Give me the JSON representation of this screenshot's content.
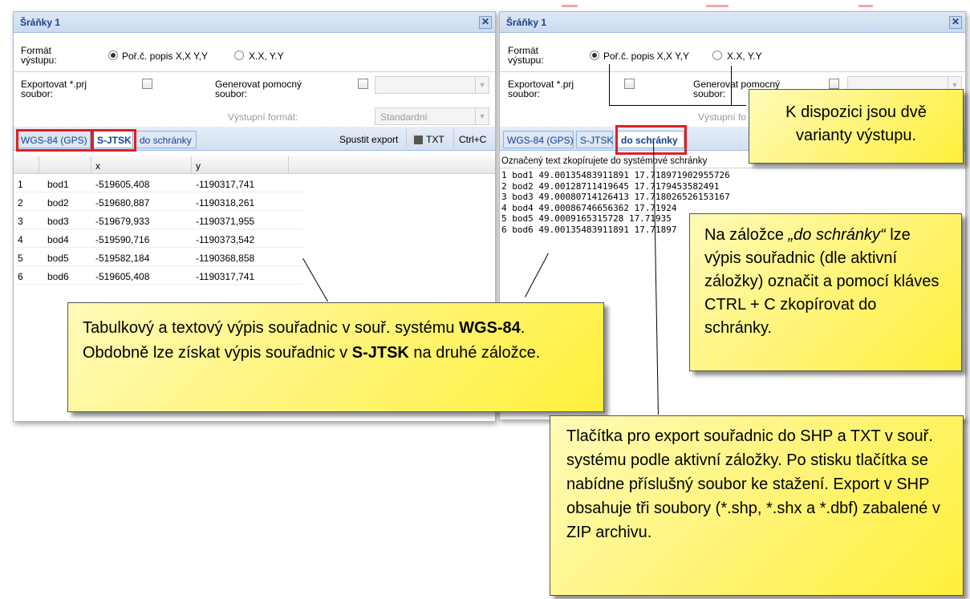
{
  "left_window": {
    "title": "Šráňky 1",
    "close_glyph": "✕",
    "format_label": "Formát výstupu:",
    "radio_options": [
      "Poř.č. popis X,X Y,Y",
      "X.X, Y.Y"
    ],
    "export_prj_label": "Exportovat *.prj soubor:",
    "generate_aux_label": "Generovat pomocný soubor:",
    "output_format_label": "Výstupní formát:",
    "output_format_value": "Standardní",
    "tabs": [
      "WGS-84 (GPS)",
      "S-JTSK",
      "do schránky"
    ],
    "buttons": {
      "export": "Spustit export",
      "txt": "TXT",
      "copy": "Ctrl+C"
    },
    "grid_headers": [
      "x",
      "y"
    ],
    "rows": [
      {
        "n": "1",
        "name": "bod1",
        "x": "-519605,408",
        "y": "-1190317,741"
      },
      {
        "n": "2",
        "name": "bod2",
        "x": "-519680,887",
        "y": "-1190318,261"
      },
      {
        "n": "3",
        "name": "bod3",
        "x": "-519679,933",
        "y": "-1190371,955"
      },
      {
        "n": "4",
        "name": "bod4",
        "x": "-519590,716",
        "y": "-1190373,542"
      },
      {
        "n": "5",
        "name": "bod5",
        "x": "-519582,184",
        "y": "-1190368,858"
      },
      {
        "n": "6",
        "name": "bod6",
        "x": "-519605,408",
        "y": "-1190317,741"
      }
    ]
  },
  "right_window": {
    "title": "Šráňky 1",
    "close_glyph": "✕",
    "format_label": "Formát výstupu:",
    "radio_options": [
      "Poř.č. popis X,X Y,Y",
      "X.X, Y.Y"
    ],
    "export_prj_label": "Exportovat *.prj soubor:",
    "generate_aux_label": "Generovat pomocný soubor:",
    "output_format_label": "Výstupní fo",
    "tabs": [
      "WGS-84 (GPS)",
      "S-JTSK",
      "do schránky"
    ],
    "clipboard_hint": "Označený text zkopírujete do systémové schránky",
    "clipboard_lines": [
      "1 bod1 49.00135483911891 17.718971902955726",
      "2 bod2 49.00128711419645 17.7179453582491",
      "3 bod3 49.00080714126413 17.718026526153167",
      "4 bod4 49.00086746656362 17.71924",
      "5 bod5 49.0009165315728 17.71935",
      "6 bod6 49.00135483911891 17.71897"
    ]
  },
  "callouts": {
    "variants": "K dispozici jsou dvě varianty výstupu.",
    "clipboard_tab": {
      "prefix": "Na záložce ",
      "italic": "„do schránky“",
      "rest": " lze výpis souřadnic (dle aktivní záložky) označit a pomocí kláves CTRL + C zkopírovat do schránky."
    },
    "table_text": {
      "part1": "Tabulkový a textový výpis souřadnic v souř. systému ",
      "bold1": "WGS-84",
      "part2": ". Obdobně lze získat výpis souřadnic v ",
      "bold2": "S-JTSK",
      "part3": " na druhé záložce."
    },
    "export_buttons": "Tlačítka pro export souřadnic do SHP a TXT v souř. systému podle aktivní záložky. Po stisku tlačítka se nabídne příslušný soubor ke stažení. Export v SHP obsahuje tři soubory (*.shp, *.shx a *.dbf) zabalené v ZIP archivu."
  },
  "colors": {
    "title_text": "#15428b",
    "window_border": "#99bbe8",
    "highlight_red": "#e02020",
    "callout_yellow": "#fff36a"
  }
}
